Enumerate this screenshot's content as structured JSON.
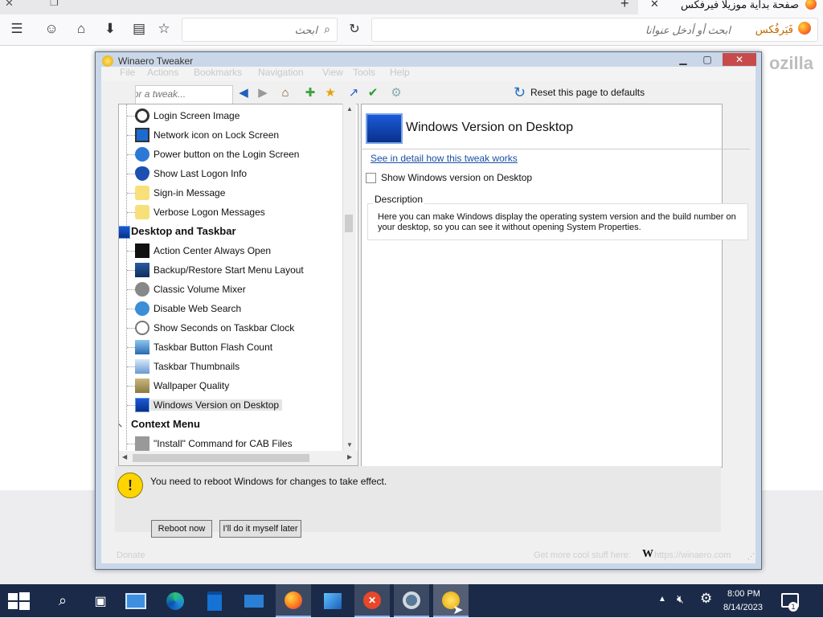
{
  "browser": {
    "tab_title": "صفحة بداية موزيلا فيرفكس",
    "new_tab_symbol": "+",
    "close_tab_symbol": "✕",
    "search_placeholder": "ابحث",
    "url_placeholder": "ابحث أو أدخل عنوانا",
    "identity_label": "فَيَرفُكس",
    "brand_word": "ozilla"
  },
  "window": {
    "title": "Winaero Tweaker",
    "menu": [
      "File",
      "Actions",
      "Bookmarks",
      "Navigation",
      "View",
      "Tools",
      "Help"
    ]
  },
  "toolbar": {
    "search_placeholder": "Search for a tweak...",
    "reset_label": "Reset this page to defaults"
  },
  "tree": {
    "items_group1": [
      {
        "label": "Login Screen Image",
        "icon": "user-icon"
      },
      {
        "label": "Network icon on Lock Screen",
        "icon": "monitor-icon"
      },
      {
        "label": "Power button on the Login Screen",
        "icon": "power-icon"
      },
      {
        "label": "Show Last Logon Info",
        "icon": "shield-question-icon"
      },
      {
        "label": "Sign-in Message",
        "icon": "message-icon"
      },
      {
        "label": "Verbose Logon Messages",
        "icon": "message-icon"
      }
    ],
    "category_desktop": "Desktop and Taskbar",
    "items_group2": [
      {
        "label": "Action Center Always Open",
        "icon": "action-center-icon"
      },
      {
        "label": "Backup/Restore Start Menu Layout",
        "icon": "start-menu-icon"
      },
      {
        "label": "Classic Volume Mixer",
        "icon": "speaker-icon"
      },
      {
        "label": "Disable Web Search",
        "icon": "globe-search-icon"
      },
      {
        "label": "Show Seconds on Taskbar Clock",
        "icon": "clock-icon"
      },
      {
        "label": "Taskbar Button Flash Count",
        "icon": "taskbar-icon"
      },
      {
        "label": "Taskbar Thumbnails",
        "icon": "thumbnail-icon"
      },
      {
        "label": "Wallpaper Quality",
        "icon": "wallpaper-icon"
      },
      {
        "label": "Windows Version on Desktop",
        "icon": "desktop-icon"
      }
    ],
    "category_context": "Context Menu",
    "items_group3": [
      {
        "label": "\"Install\" Command for CAB Files",
        "icon": "cab-icon"
      }
    ]
  },
  "detail": {
    "title": "Windows Version on Desktop",
    "link": "See in detail how this tweak works",
    "checkbox_label": "Show Windows version on Desktop",
    "description_label": "Description",
    "description_text": "Here you can make Windows display the operating system version and the build number on your desktop, so you can see it without opening System Properties."
  },
  "reboot": {
    "message": "You need to reboot Windows for changes to take effect.",
    "reboot_now": "Reboot now",
    "later": "I'll do it myself later"
  },
  "statusbar": {
    "donate": "Donate",
    "get_more": "Get more cool stuff here:",
    "w_logo": "W",
    "site": "https://winaero.com"
  },
  "taskbar": {
    "time": "8:00 PM",
    "date": "8/14/2023",
    "notification_count": "1"
  },
  "colors": {
    "taskbar": "#1b2a48",
    "link": "#1a4fa3",
    "window_frame": "#c9d7e8",
    "warning": "#ffd400"
  }
}
